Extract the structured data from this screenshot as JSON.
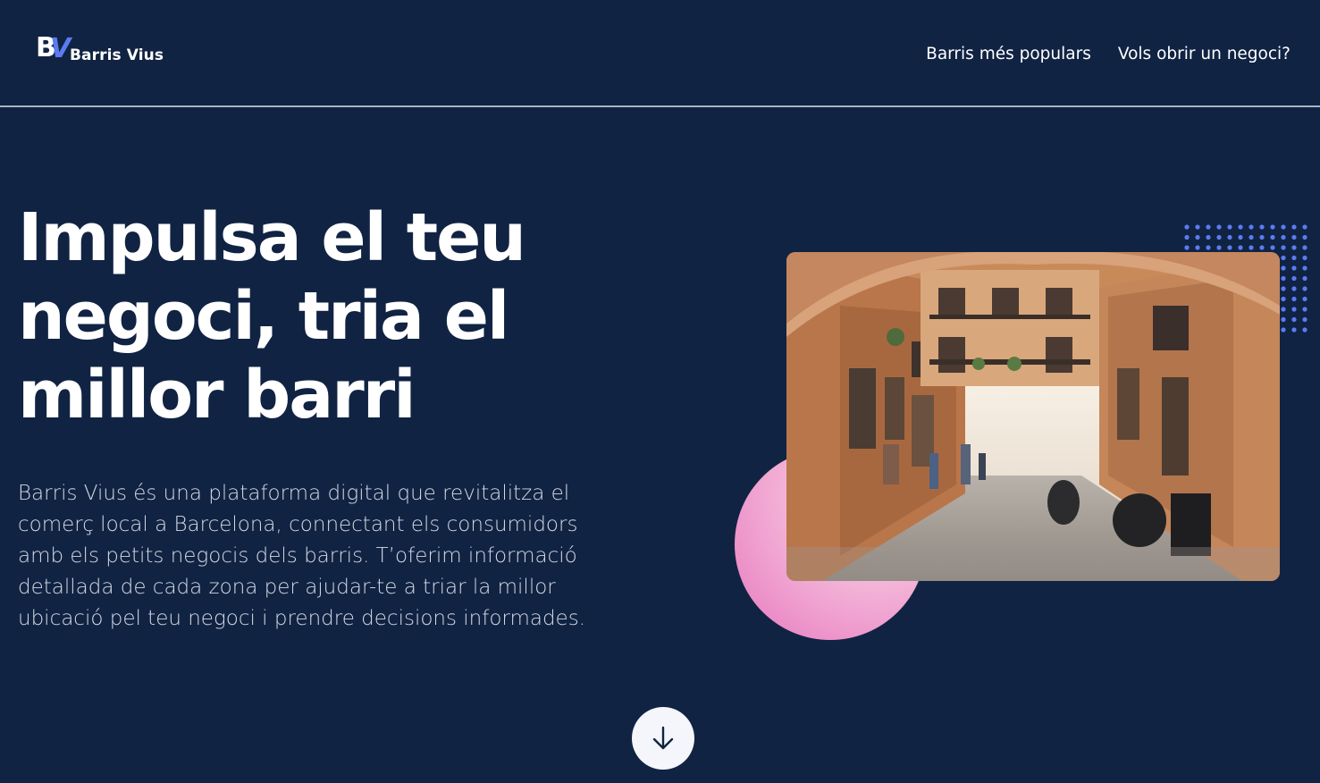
{
  "header": {
    "logo_text": "Barris Vius",
    "logo_mark_b": "B",
    "logo_mark_v": "V",
    "nav": [
      {
        "label": "Barris més populars"
      },
      {
        "label": "Vols obrir un negoci?"
      }
    ]
  },
  "hero": {
    "title": "Impulsa el teu negoci, tria el millor barri",
    "description": "Barris Vius és una plataforma digital que revitalitza el comerç local a Barcelona, connectant els consumidors amb els petits negocis dels barris. T’oferim informació detallada de cada zona per ajudar-te a triar la millor ubicació pel teu negoci i prendre decisions informades."
  },
  "scroll_button": {
    "icon": "arrow-down-icon"
  },
  "colors": {
    "background": "#112343",
    "accent": "#5b7cf0",
    "pink": "#e777bf",
    "text": "#ffffff"
  }
}
